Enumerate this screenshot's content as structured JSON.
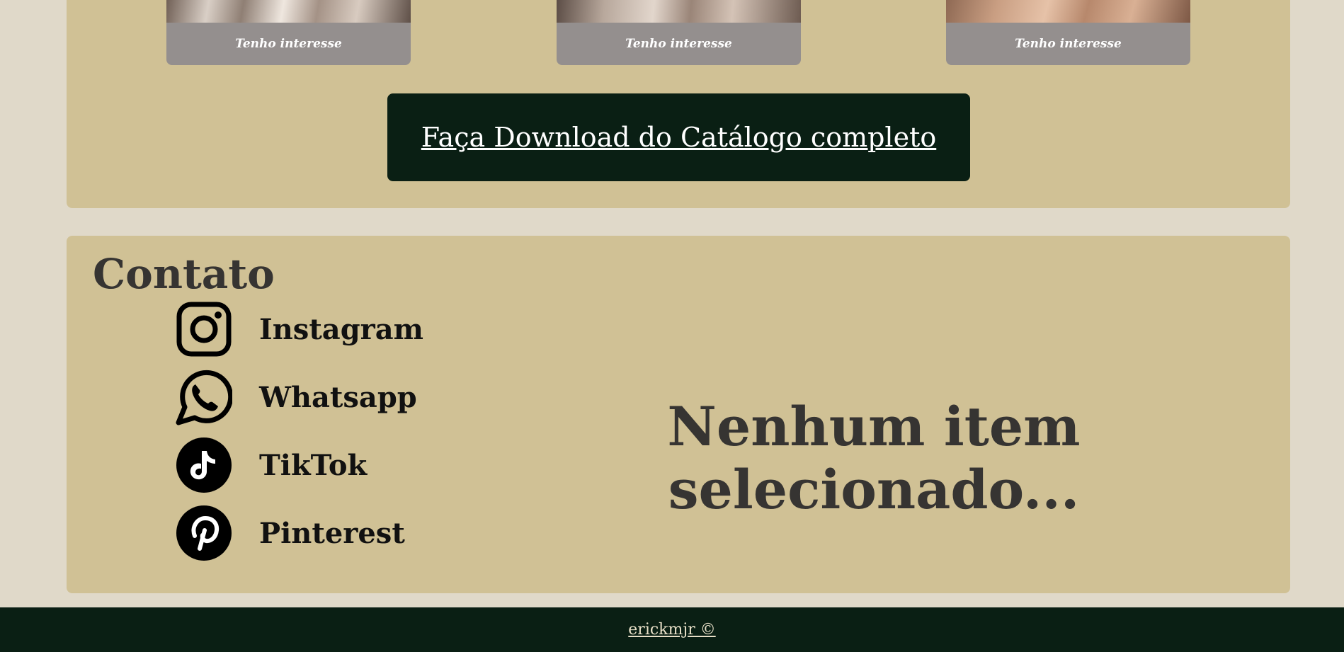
{
  "catalog": {
    "products": [
      {
        "button_label": "Tenho interesse",
        "photo": "satin-fabric-image"
      },
      {
        "button_label": "Tenho interesse",
        "photo": "satin-fabric-image"
      },
      {
        "button_label": "Tenho interesse",
        "photo": "satin-fabric-image"
      }
    ],
    "download_label": "Faça Download do Catálogo completo"
  },
  "contact": {
    "title": "Contato",
    "links": [
      {
        "label": "Instagram",
        "icon": "instagram-icon"
      },
      {
        "label": "Whatsapp",
        "icon": "whatsapp-icon"
      },
      {
        "label": "TikTok",
        "icon": "tiktok-icon"
      },
      {
        "label": "Pinterest",
        "icon": "pinterest-icon"
      }
    ],
    "empty_selection_text": "Nenhum item selecionado..."
  },
  "footer": {
    "credit": "erickmjr ©"
  },
  "colors": {
    "page_background": "#e0d9c9",
    "panel_background": "#d0c195",
    "dark_green": "#0a1f14",
    "interest_button": "#948f8e",
    "heading_text": "#363432"
  }
}
